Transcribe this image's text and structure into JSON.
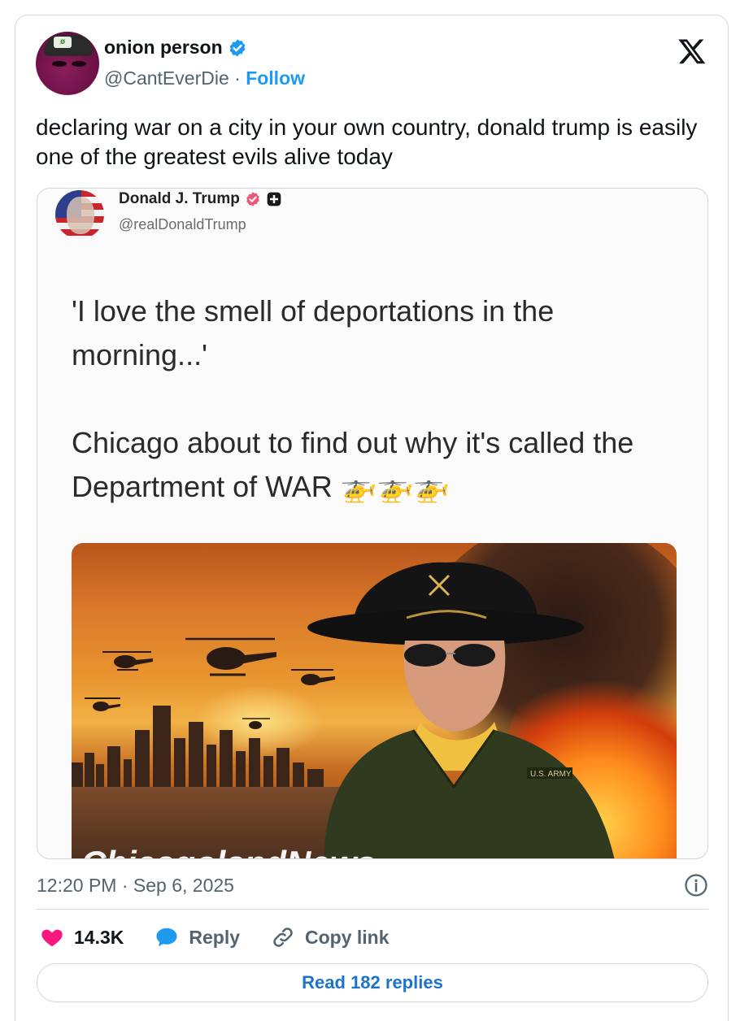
{
  "author": {
    "display_name": "onion person",
    "handle": "@CantEverDie",
    "separator": "·",
    "follow_label": "Follow",
    "verified": true,
    "verified_color": "#1d9bf0"
  },
  "tweet": {
    "text": "declaring war on a city in your own country, donald trump is easily one of the greatest evils alive today",
    "timestamp": "12:20 PM · Sep 6, 2025"
  },
  "embedded_post": {
    "display_name": "Donald J. Trump",
    "handle": "@realDonaldTrump",
    "paragraph_1": "'I love the smell of deportations in the morning...'",
    "paragraph_2": "Chicago about to find out why it's called the Department of WAR 🚁🚁🚁",
    "image_watermark": "ChicagolandNews"
  },
  "actions": {
    "like_count": "14.3K",
    "reply_label": "Reply",
    "copy_link_label": "Copy link",
    "like_color": "#f91880",
    "reply_color": "#1d9bf0"
  },
  "read_replies_label": "Read 182 replies",
  "icons": {
    "brand": "x-logo-icon",
    "verified": "verified-badge-icon",
    "info": "info-icon",
    "like": "heart-icon",
    "reply": "speech-bubble-icon",
    "copy_link": "link-icon"
  }
}
